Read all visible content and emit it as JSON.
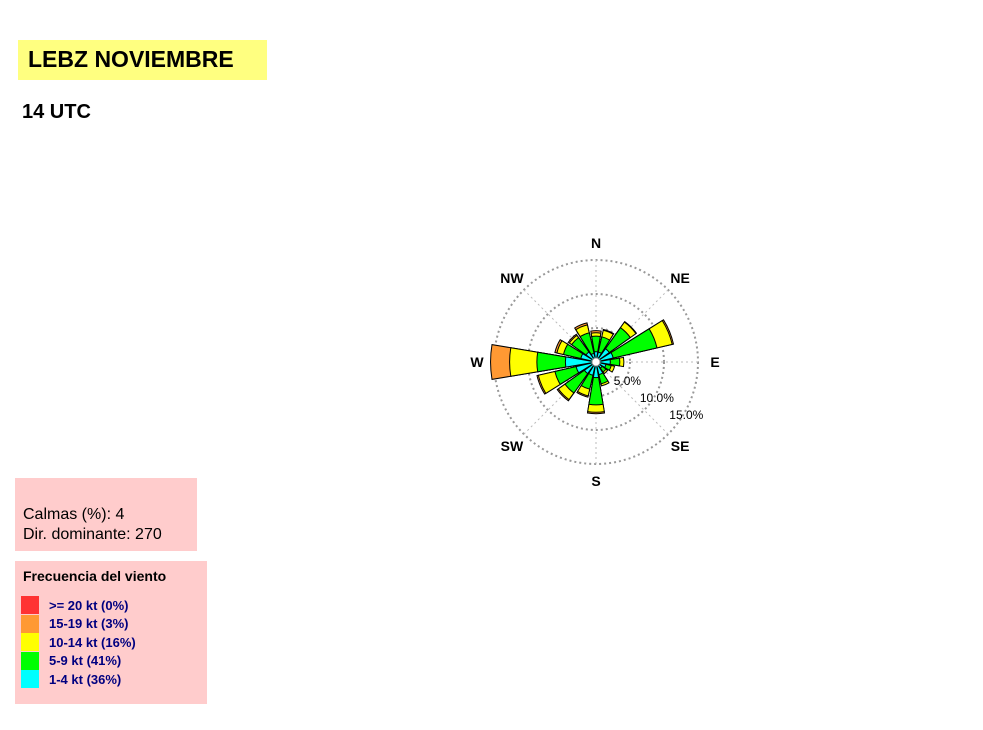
{
  "header": {
    "title": "LEBZ NOVIEMBRE",
    "subtitle": "14 UTC"
  },
  "summary": {
    "calm_text": "Calmas (%): 4",
    "dominant_text": "Dir. dominante:  270"
  },
  "legend": {
    "title": "Frecuencia del viento",
    "items": [
      {
        "label": ">= 20 kt (0%)",
        "color": "#ff3333"
      },
      {
        "label": "15-19 kt (3%)",
        "color": "#ff9933"
      },
      {
        "label": "10-14 kt (16%)",
        "color": "#ffff00"
      },
      {
        "label": "5-9 kt (41%)",
        "color": "#00ff00"
      },
      {
        "label": "1-4 kt (36%)",
        "color": "#00ffff"
      }
    ]
  },
  "chart_data": {
    "type": "wind-rose",
    "compass_labels": [
      "N",
      "NE",
      "E",
      "SE",
      "S",
      "SW",
      "W",
      "NW"
    ],
    "ring_labels": [
      "5.0%",
      "10.0%",
      "15.0%"
    ],
    "rings_percent": [
      5,
      10,
      15
    ],
    "speed_bins": [
      "1-4 kt",
      "5-9 kt",
      "10-14 kt",
      "15-19 kt",
      ">= 20 kt"
    ],
    "bin_colors": [
      "#00ffff",
      "#00ff00",
      "#ffff00",
      "#ff9933",
      "#ff3333"
    ],
    "directions_deg": [
      0,
      22.5,
      45,
      67.5,
      90,
      112.5,
      135,
      157.5,
      180,
      202.5,
      225,
      247.5,
      270,
      292.5,
      315,
      337.5
    ],
    "cumulative_percent": [
      [
        1.5,
        3.8,
        4.3,
        4.6,
        4.6
      ],
      [
        1.5,
        3.8,
        4.8,
        4.9,
        4.9
      ],
      [
        2.4,
        6.2,
        7.2,
        7.3,
        7.3
      ],
      [
        2.6,
        9.2,
        11.5,
        11.7,
        11.7
      ],
      [
        2.1,
        3.5,
        4.1,
        4.1,
        4.1
      ],
      [
        1.5,
        2.3,
        2.8,
        2.8,
        2.8
      ],
      [
        1.1,
        1.8,
        2.1,
        2.1,
        2.1
      ],
      [
        1.9,
        3.3,
        3.6,
        3.6,
        3.6
      ],
      [
        2.3,
        6.3,
        7.4,
        7.6,
        7.6
      ],
      [
        2.0,
        4.1,
        5.1,
        5.3,
        5.3
      ],
      [
        2.1,
        5.6,
        6.8,
        7.0,
        7.0
      ],
      [
        3.0,
        6.2,
        8.7,
        8.9,
        8.9
      ],
      [
        4.5,
        8.7,
        12.7,
        15.5,
        15.5
      ],
      [
        2.3,
        4.9,
        5.9,
        6.2,
        6.2
      ],
      [
        1.8,
        4.4,
        4.8,
        5.0,
        5.0
      ],
      [
        1.3,
        4.4,
        5.6,
        5.9,
        5.9
      ]
    ]
  }
}
